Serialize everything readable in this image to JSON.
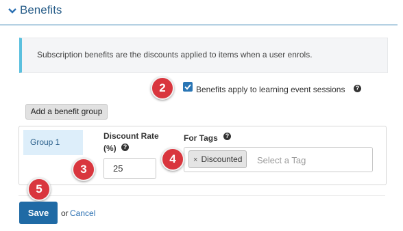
{
  "section": {
    "title": "Benefits",
    "icon": "chevron-down-icon"
  },
  "info": {
    "text": "Subscription benefits are the discounts applied to items when a user enrols."
  },
  "option": {
    "label": "Benefits apply to learning event sessions",
    "checked": true
  },
  "toolbar": {
    "add_group_label": "Add a benefit group"
  },
  "group": {
    "tab_label": "Group 1",
    "discount_label_line1": "Discount Rate",
    "discount_label_line2": "(%)",
    "discount_value": "25",
    "tags_label": "For Tags",
    "tags": [
      {
        "label": "Discounted",
        "remove": "×"
      }
    ],
    "tags_placeholder": "Select a Tag"
  },
  "help_glyph": "?",
  "badges": {
    "b2": "2",
    "b3": "3",
    "b4": "4",
    "b5": "5"
  },
  "footer": {
    "save_label": "Save",
    "or_text": "or",
    "cancel_label": "Cancel"
  },
  "colors": {
    "accent": "#1f6aa5",
    "info_border": "#5bc0de",
    "badge": "#d9363e",
    "tab_bg": "#ddeefa"
  }
}
